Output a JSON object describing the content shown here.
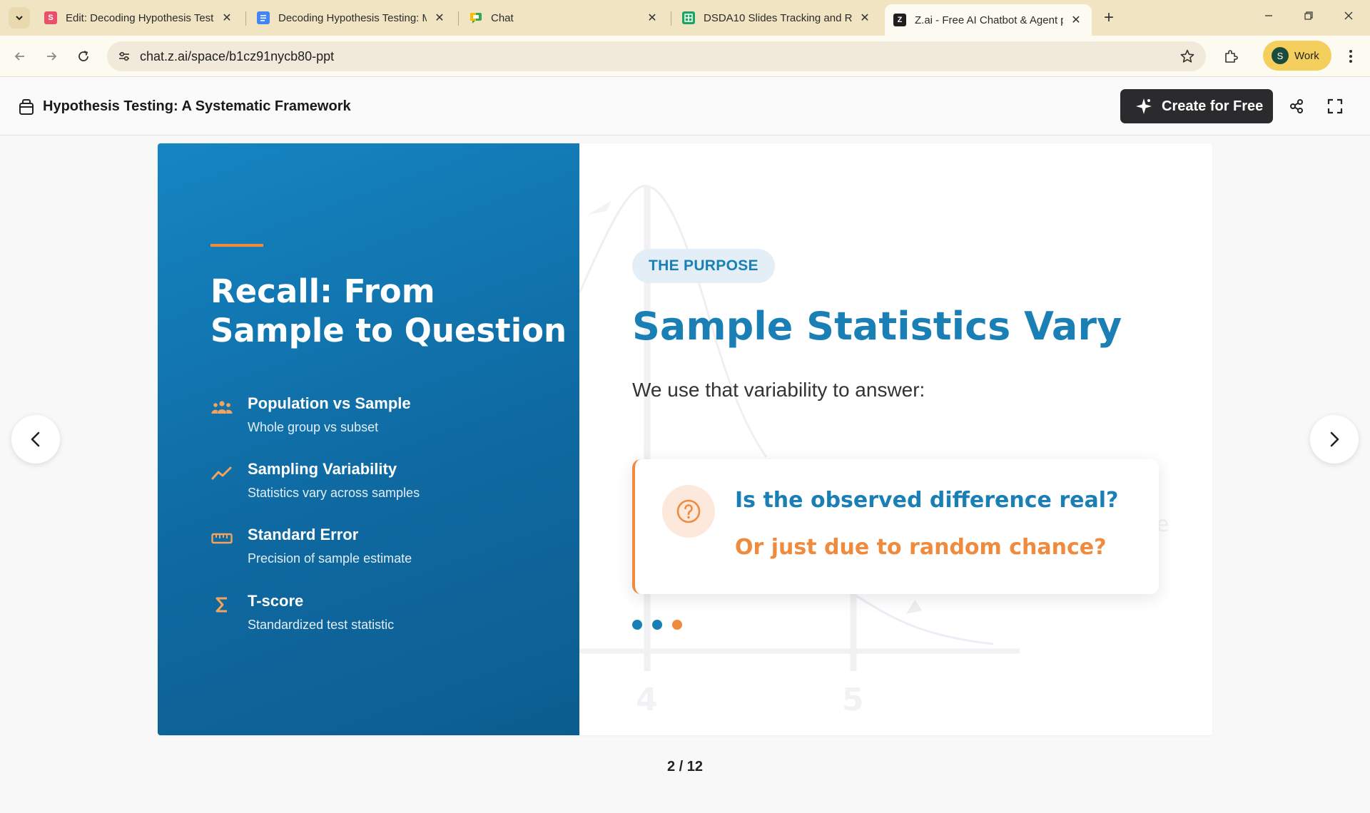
{
  "browser": {
    "tabs": [
      {
        "title": "Edit: Decoding Hypothesis Testi",
        "favicon": "slides-s-icon",
        "active": false
      },
      {
        "title": "Decoding Hypothesis Testing: M",
        "favicon": "docs-icon",
        "active": false
      },
      {
        "title": "Chat",
        "favicon": "google-chat-icon",
        "active": false
      },
      {
        "title": "DSDA10 Slides Tracking and Re",
        "favicon": "sheets-icon",
        "active": false
      },
      {
        "title": "Z.ai - Free AI Chatbot & Agent p",
        "favicon": "zai-icon",
        "active": true
      }
    ],
    "favicon_letter_s": "S",
    "url": "chat.z.ai/space/b1cz91nycb80-ppt",
    "profile": {
      "initial": "S",
      "label": "Work"
    }
  },
  "app": {
    "doc_title": "Hypothesis Testing: A Systematic Framework",
    "create_label": "Create for Free"
  },
  "slide": {
    "left": {
      "title": "Recall: From Sample to Question",
      "features": [
        {
          "icon": "people-icon",
          "name": "Population vs Sample",
          "desc": "Whole group vs subset"
        },
        {
          "icon": "trend-line-icon",
          "name": "Sampling Variability",
          "desc": "Statistics vary across samples"
        },
        {
          "icon": "ruler-icon",
          "name": "Standard Error",
          "desc": "Precision of sample estimate"
        },
        {
          "icon": "sigma-icon",
          "name": "T-score",
          "desc": "Standardized test statistic"
        }
      ]
    },
    "right": {
      "tag": "THE PURPOSE",
      "title": "Sample Statistics Vary",
      "subtitle": "We use that variability to answer:",
      "question_1": "Is the observed difference real?",
      "question_2": "Or just due to random chance?",
      "bg_axis_labels": [
        "4",
        "5"
      ],
      "bg_partial_text": "e"
    },
    "dots": [
      "#1a7fb4",
      "#1a7fb4",
      "#f08a3c"
    ]
  },
  "pager": "2 / 12",
  "colors": {
    "primary_blue": "#1a7fb4",
    "accent_orange": "#f08a3c",
    "tabstrip": "#f0e4c2",
    "dark_button": "#2b2b2e"
  }
}
